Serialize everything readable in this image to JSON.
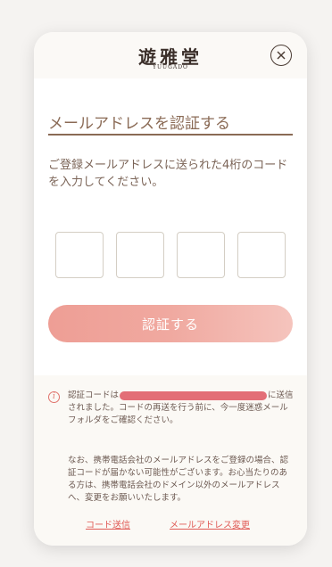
{
  "header": {
    "logo_main": "遊雅堂",
    "logo_sub": "YUUGADO",
    "close_icon": "close-circle-icon"
  },
  "main": {
    "title": "メールアドレスを認証する",
    "description": "ご登録メールアドレスに送られた4桁のコードを入力してください。",
    "code_inputs": [
      "",
      "",
      "",
      ""
    ],
    "submit_label": "認証する"
  },
  "footer": {
    "info_icon": "info-icon",
    "note_prefix": "認証コードは",
    "note_suffix": "に送信されました。コードの再送を行う前に、今一度迷惑メールフォルダをご確認ください。",
    "note2": "なお、携帯電話会社のメールアドレスをご登録の場合、認証コードが届かない可能性がございます。お心当たりのある方は、携帯電話会社のドメイン以外のメールアドレスへ、変更をお願いいたします。",
    "resend_link": "コード送信",
    "change_email_link": "メールアドレス変更"
  },
  "colors": {
    "accent": "#e05a55",
    "button": "#f0a9a0",
    "title": "#8a6a55",
    "redaction": "#e36e77"
  }
}
